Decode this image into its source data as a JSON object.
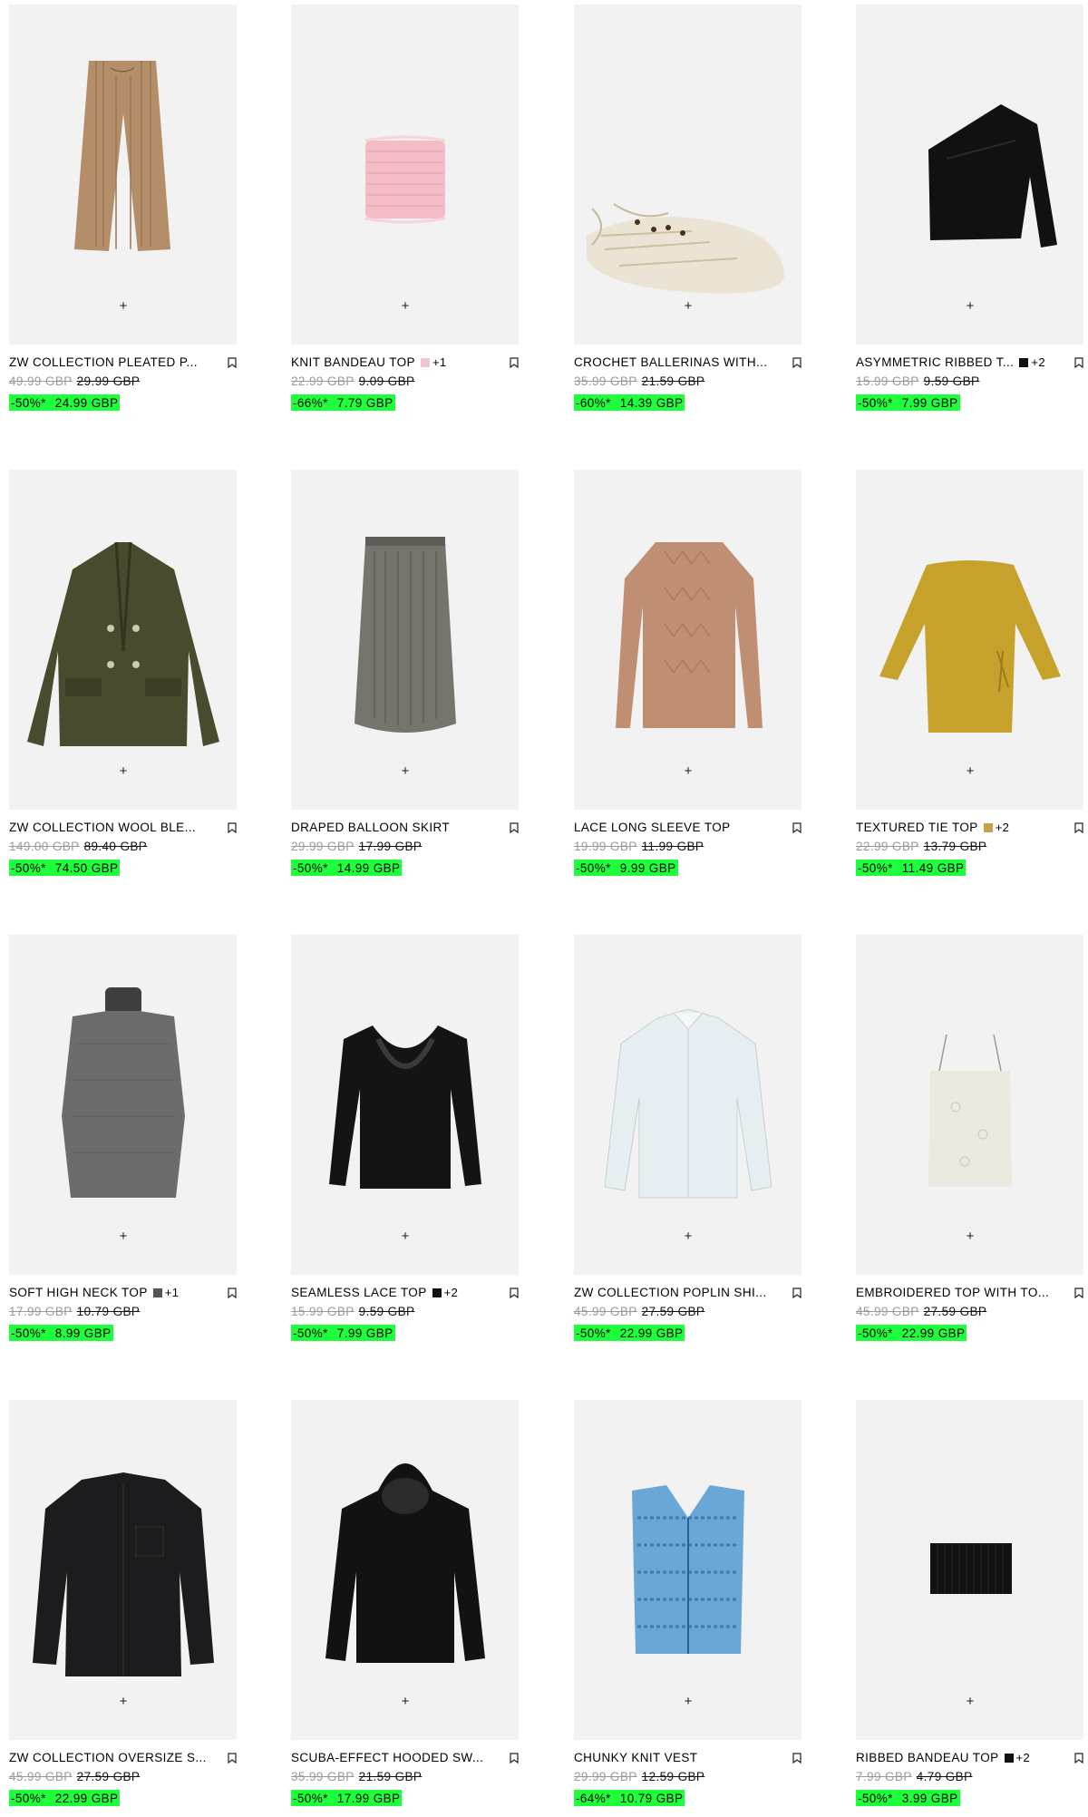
{
  "products": [
    {
      "name": "ZW COLLECTION PLEATED P...",
      "swatch": null,
      "more": "",
      "orig": "49.99 GBP",
      "prev": "29.99 GBP",
      "disc": "-50%*",
      "price": "24.99 GBP",
      "add": "+",
      "icon": "pleated-trousers"
    },
    {
      "name": "KNIT BANDEAU TOP",
      "swatch": "#f1c6cf",
      "more": "+1",
      "orig": "22.99 GBP",
      "prev": "9.09 GBP",
      "disc": "-66%*",
      "price": "7.79 GBP",
      "add": "+",
      "icon": "pink-bandeau"
    },
    {
      "name": "CROCHET BALLERINAS WITH...",
      "swatch": null,
      "more": "",
      "orig": "35.99 GBP",
      "prev": "21.59 GBP",
      "disc": "-60%*",
      "price": "14.39 GBP",
      "add": "+",
      "icon": "crochet-ballerina"
    },
    {
      "name": "ASYMMETRIC RIBBED T...",
      "swatch": "#111111",
      "more": "+2",
      "orig": "15.99 GBP",
      "prev": "9.59 GBP",
      "disc": "-50%*",
      "price": "7.99 GBP",
      "add": "+",
      "icon": "asymmetric-top"
    },
    {
      "name": "ZW COLLECTION WOOL BLE...",
      "swatch": null,
      "more": "",
      "orig": "149.00 GBP",
      "prev": "89.40 GBP",
      "disc": "-50%*",
      "price": "74.50 GBP",
      "add": "+",
      "icon": "wool-coat"
    },
    {
      "name": "DRAPED BALLOON SKIRT",
      "swatch": null,
      "more": "",
      "orig": "29.99 GBP",
      "prev": "17.99 GBP",
      "disc": "-50%*",
      "price": "14.99 GBP",
      "add": "+",
      "icon": "balloon-skirt"
    },
    {
      "name": "LACE LONG SLEEVE TOP",
      "swatch": null,
      "more": "",
      "orig": "19.99 GBP",
      "prev": "11.99 GBP",
      "disc": "-50%*",
      "price": "9.99 GBP",
      "add": "+",
      "icon": "lace-top"
    },
    {
      "name": "TEXTURED TIE TOP",
      "swatch": "#c4a24a",
      "more": "+2",
      "orig": "22.99 GBP",
      "prev": "13.79 GBP",
      "disc": "-50%*",
      "price": "11.49 GBP",
      "add": "+",
      "icon": "tie-top"
    },
    {
      "name": "SOFT HIGH NECK TOP",
      "swatch": "#555555",
      "more": "+1",
      "orig": "17.99 GBP",
      "prev": "10.79 GBP",
      "disc": "-50%*",
      "price": "8.99 GBP",
      "add": "+",
      "icon": "high-neck-top"
    },
    {
      "name": "SEAMLESS LACE TOP",
      "swatch": "#111111",
      "more": "+2",
      "orig": "15.99 GBP",
      "prev": "9.59 GBP",
      "disc": "-50%*",
      "price": "7.99 GBP",
      "add": "+",
      "icon": "seamless-lace-top"
    },
    {
      "name": "ZW COLLECTION POPLIN SHI...",
      "swatch": null,
      "more": "",
      "orig": "45.99 GBP",
      "prev": "27.59 GBP",
      "disc": "-50%*",
      "price": "22.99 GBP",
      "add": "+",
      "icon": "poplin-shirt"
    },
    {
      "name": "EMBROIDERED TOP WITH TO...",
      "swatch": null,
      "more": "",
      "orig": "45.99 GBP",
      "prev": "27.59 GBP",
      "disc": "-50%*",
      "price": "22.99 GBP",
      "add": "+",
      "icon": "embroidered-top"
    },
    {
      "name": "ZW COLLECTION OVERSIZE S...",
      "swatch": null,
      "more": "",
      "orig": "45.99 GBP",
      "prev": "27.59 GBP",
      "disc": "-50%*",
      "price": "22.99 GBP",
      "add": "+",
      "icon": "oversize-shirt"
    },
    {
      "name": "SCUBA-EFFECT HOODED SW...",
      "swatch": null,
      "more": "",
      "orig": "35.99 GBP",
      "prev": "21.59 GBP",
      "disc": "-50%*",
      "price": "17.99 GBP",
      "add": "+",
      "icon": "hooded-sweatshirt"
    },
    {
      "name": "CHUNKY KNIT VEST",
      "swatch": null,
      "more": "",
      "orig": "29.99 GBP",
      "prev": "12.59 GBP",
      "disc": "-64%*",
      "price": "10.79 GBP",
      "add": "+",
      "icon": "knit-vest"
    },
    {
      "name": "RIBBED BANDEAU TOP",
      "swatch": "#111111",
      "more": "+2",
      "orig": "7.99 GBP",
      "prev": "4.79 GBP",
      "disc": "-50%*",
      "price": "3.99 GBP",
      "add": "+",
      "icon": "ribbed-bandeau"
    }
  ],
  "colors": {
    "discount_bg": "#1cff3a",
    "image_bg": "#f2f2f2",
    "strike_grey": "#9a9a9a"
  }
}
